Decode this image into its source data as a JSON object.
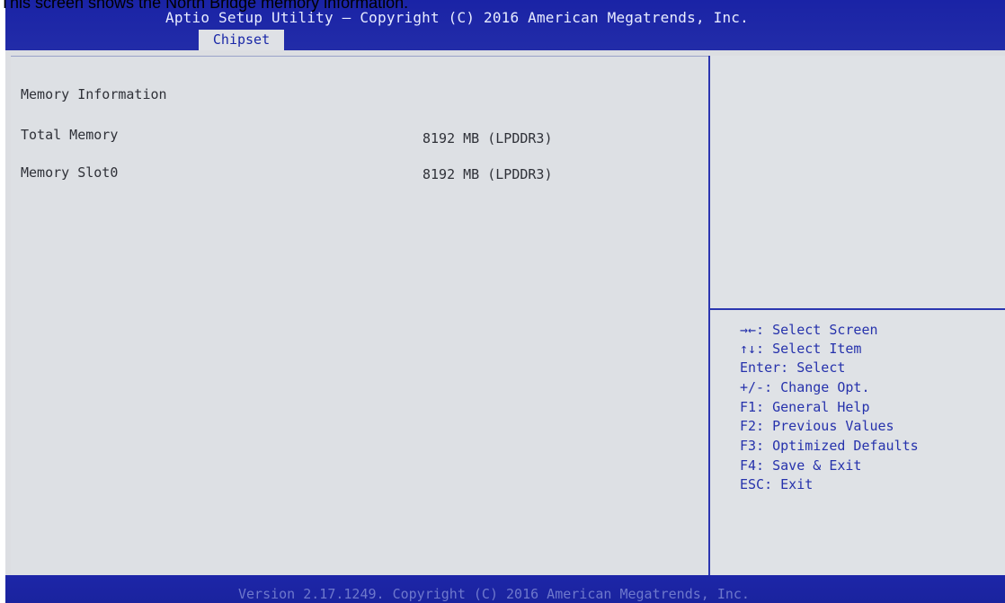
{
  "caption": "This screen shows the North Bridge memory information.",
  "header": {
    "title": "Aptio Setup Utility – Copyright (C) 2016 American Megatrends, Inc.",
    "active_tab": "Chipset"
  },
  "main": {
    "section_title": "Memory Information",
    "rows": [
      {
        "label": "Total Memory",
        "value": "8192 MB (LPDDR3)"
      },
      {
        "label": "Memory Slot0",
        "value": "8192 MB (LPDDR3)"
      }
    ]
  },
  "help": {
    "keys": [
      "→←: Select Screen",
      "↑↓: Select Item",
      "Enter: Select",
      "+/-: Change Opt.",
      "F1: General Help",
      "F2: Previous Values",
      "F3: Optimized Defaults",
      "F4: Save & Exit",
      "ESC: Exit"
    ]
  },
  "footer": {
    "version": "Version 2.17.1249. Copyright (C) 2016 American Megatrends, Inc."
  },
  "colors": {
    "header_bg": "#1a23a6",
    "body_bg": "#dcdee2",
    "help_text": "#2632ac",
    "body_text": "#2f3138"
  }
}
